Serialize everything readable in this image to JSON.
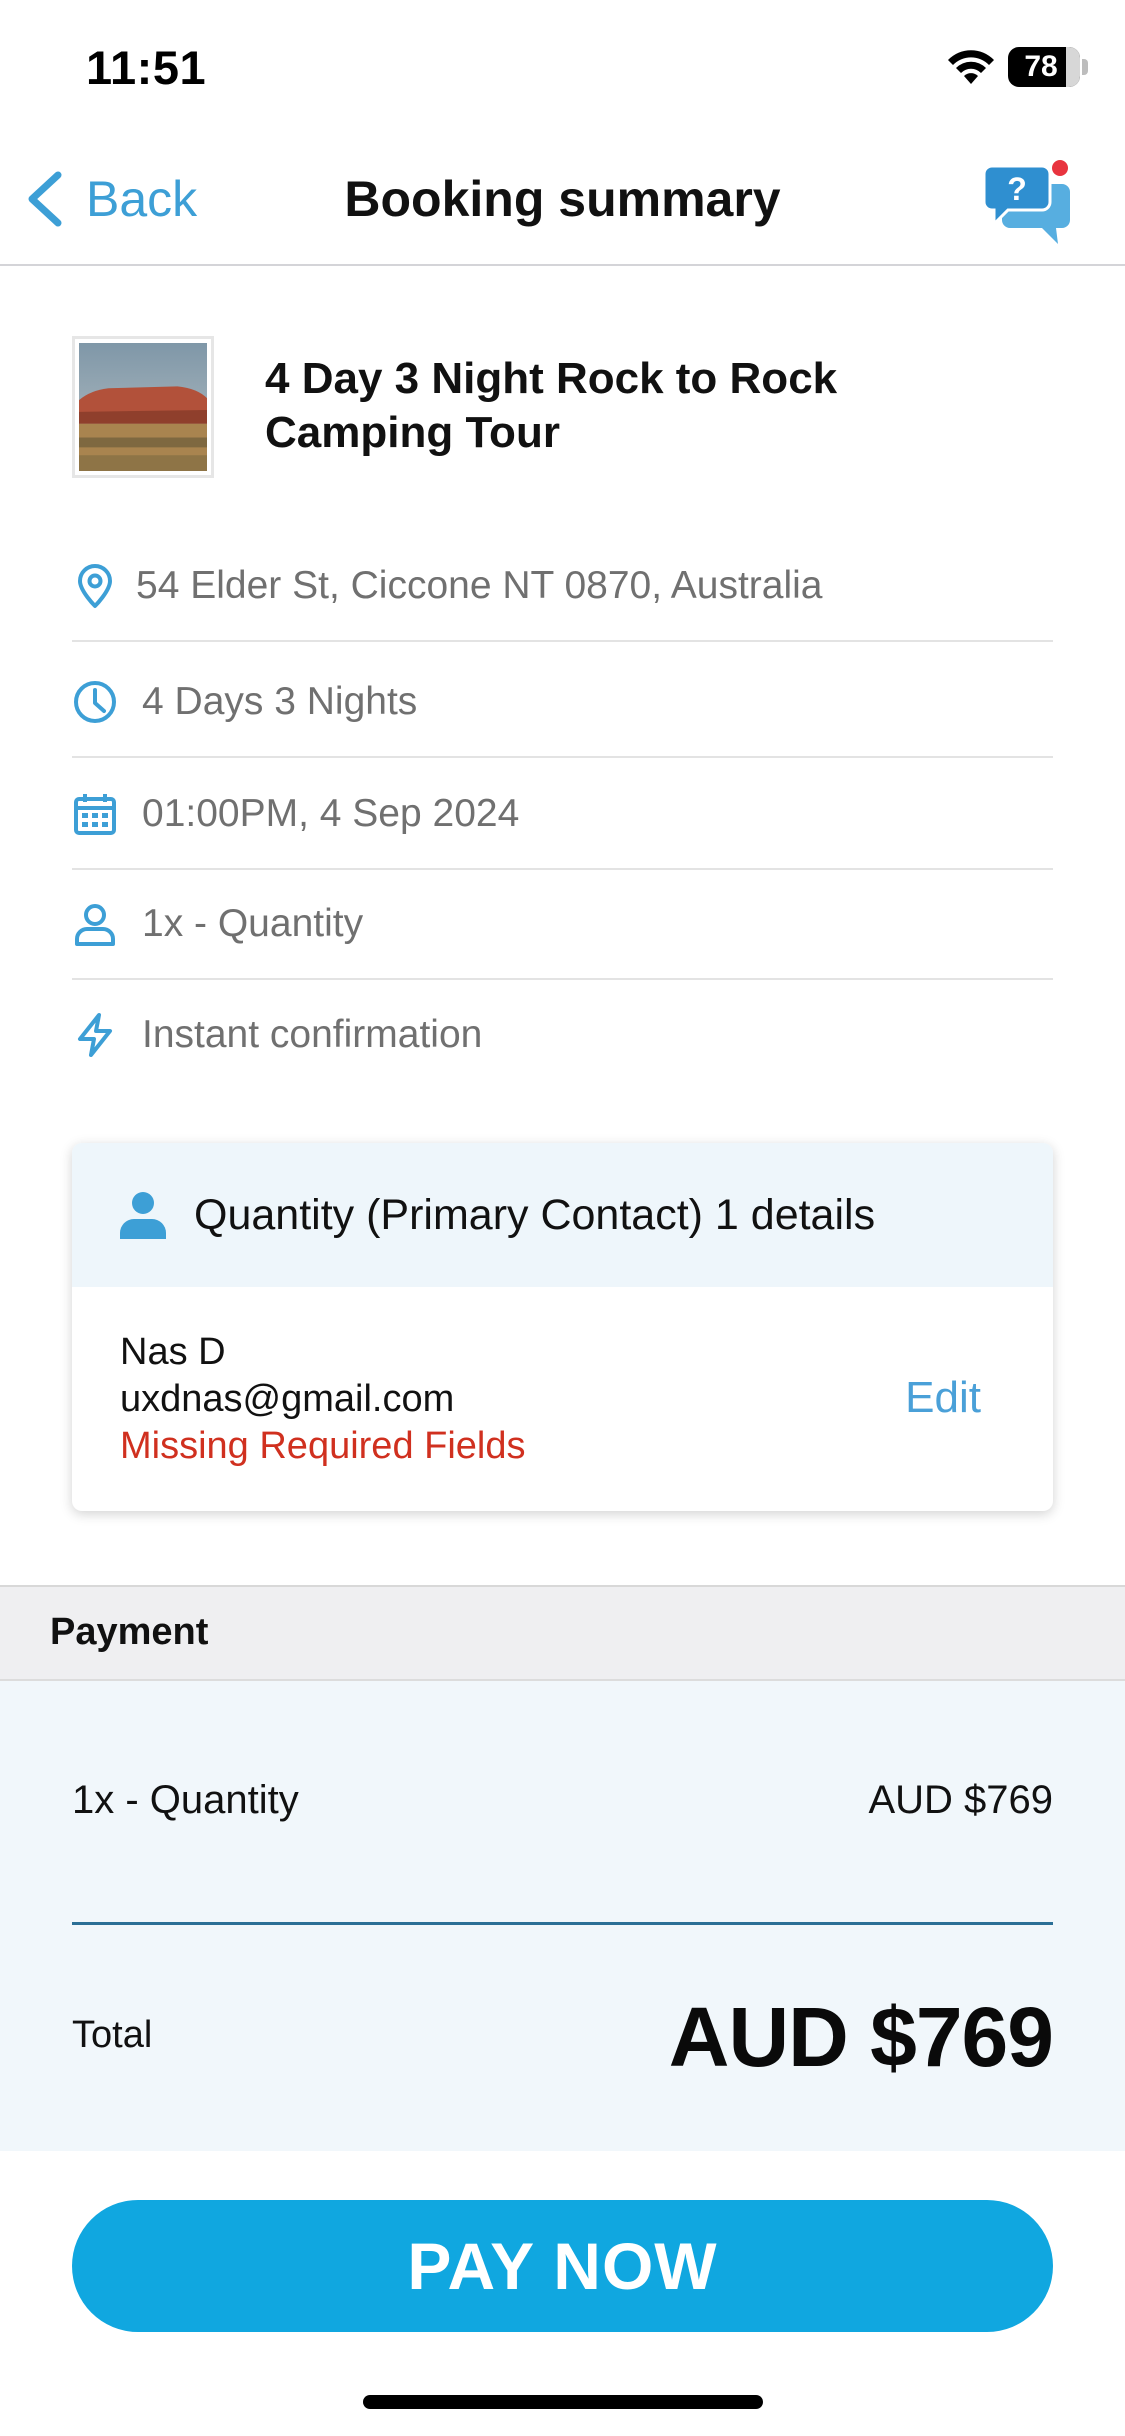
{
  "status_bar": {
    "time": "11:51",
    "battery": "78"
  },
  "nav": {
    "back_label": "Back",
    "title": "Booking summary"
  },
  "tour": {
    "title": "4 Day 3 Night Rock to Rock Camping Tour"
  },
  "details": [
    {
      "icon": "location-pin-icon",
      "text": "54 Elder St, Ciccone NT 0870, Australia"
    },
    {
      "icon": "clock-icon",
      "text": "4 Days 3 Nights"
    },
    {
      "icon": "calendar-icon",
      "text": "01:00PM, 4 Sep 2024"
    },
    {
      "icon": "person-icon",
      "text": "1x - Quantity"
    },
    {
      "icon": "lightning-icon",
      "text": "Instant confirmation"
    }
  ],
  "contact": {
    "header": "Quantity (Primary Contact) 1 details",
    "name": "Nas D",
    "email": "uxdnas@gmail.com",
    "warning": "Missing Required Fields",
    "edit_label": "Edit"
  },
  "payment": {
    "header": "Payment",
    "line_label": "1x - Quantity",
    "line_price": "AUD $769",
    "total_label": "Total",
    "total_amount": "AUD $769"
  },
  "actions": {
    "pay_label": "PAY NOW"
  },
  "colors": {
    "accent": "#3d9fd6",
    "pay_button": "#10a7e0",
    "warning": "#d0301f",
    "badge": "#e8343f"
  }
}
